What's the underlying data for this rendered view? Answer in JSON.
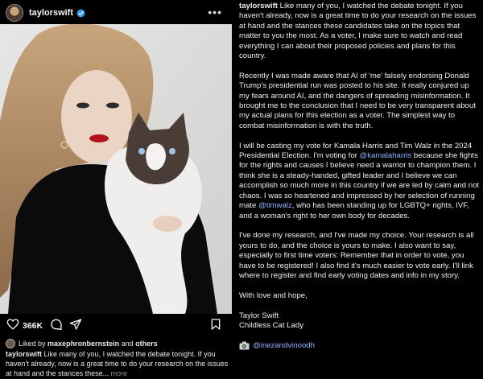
{
  "post": {
    "username": "taylorswift",
    "more_label": "•••"
  },
  "actions": {
    "likes_count": "366K",
    "like_icon": "heart-icon",
    "comment_icon": "comment-icon",
    "share_icon": "share-icon",
    "save_icon": "bookmark-icon"
  },
  "liked_by": {
    "prefix": "Liked by",
    "user": "maxephronbernstein",
    "and": "and",
    "others": "others"
  },
  "caption": {
    "username": "taylorswift",
    "text": "Like many of you, I watched the debate tonight. If you haven't already, now is a great time to do your research on the issues at hand and the stances these...",
    "more_label": "more"
  },
  "full_caption": {
    "username": "taylorswift",
    "p1": "Like many of you, I watched the debate tonight. If you haven't already, now is a great time to do your research on the issues at hand and the stances these candidates take on the topics that matter to you the most. As a voter, I make sure to watch and read everything I can about their proposed policies and plans for this country.",
    "p2": "Recently I was made aware that AI of 'me' falsely endorsing Donald Trump's presidential run was posted to his site. It really conjured up my fears around AI, and the dangers of spreading misinformation. It brought me to the conclusion that I need to be very transparent about my actual plans for this election as a voter. The simplest way to combat misinformation is with the truth.",
    "p3_a": "I will be casting my vote for Kamala Harris and Tim Walz in the 2024 Presidential Election. I'm voting for",
    "p3_mention1": "@kamalaharris",
    "p3_b": "because she fights for the rights and causes I believe need a warrior to champion them. I think she is a steady-handed, gifted leader and I believe we can accomplish so much more in this country if we are led by calm and not chaos. I was so heartened and impressed by her selection of running mate",
    "p3_mention2": "@timwalz",
    "p3_c": ", who has been standing up for LGBTQ+ rights, IVF, and a woman's right to her own body for decades.",
    "p4": "I've done my research, and I've made my choice. Your research is all yours to do, and the choice is yours to make. I also want to say, especially to first time voters: Remember that in order to vote, you have to be registered! I also find it's much easier to vote early. I'll link where to register and find early voting dates and info in my story.",
    "p5": "With love and hope,",
    "sign1": "Taylor Swift",
    "sign2": "Childless Cat Lady",
    "credit_icon": "camera-icon",
    "credit_mention": "@inezandvinoodh"
  },
  "colors": {
    "background": "#000000",
    "text": "#efefef",
    "mention": "#8fb3ff",
    "verified": "#3897f0",
    "muted": "#8f8f8f"
  }
}
